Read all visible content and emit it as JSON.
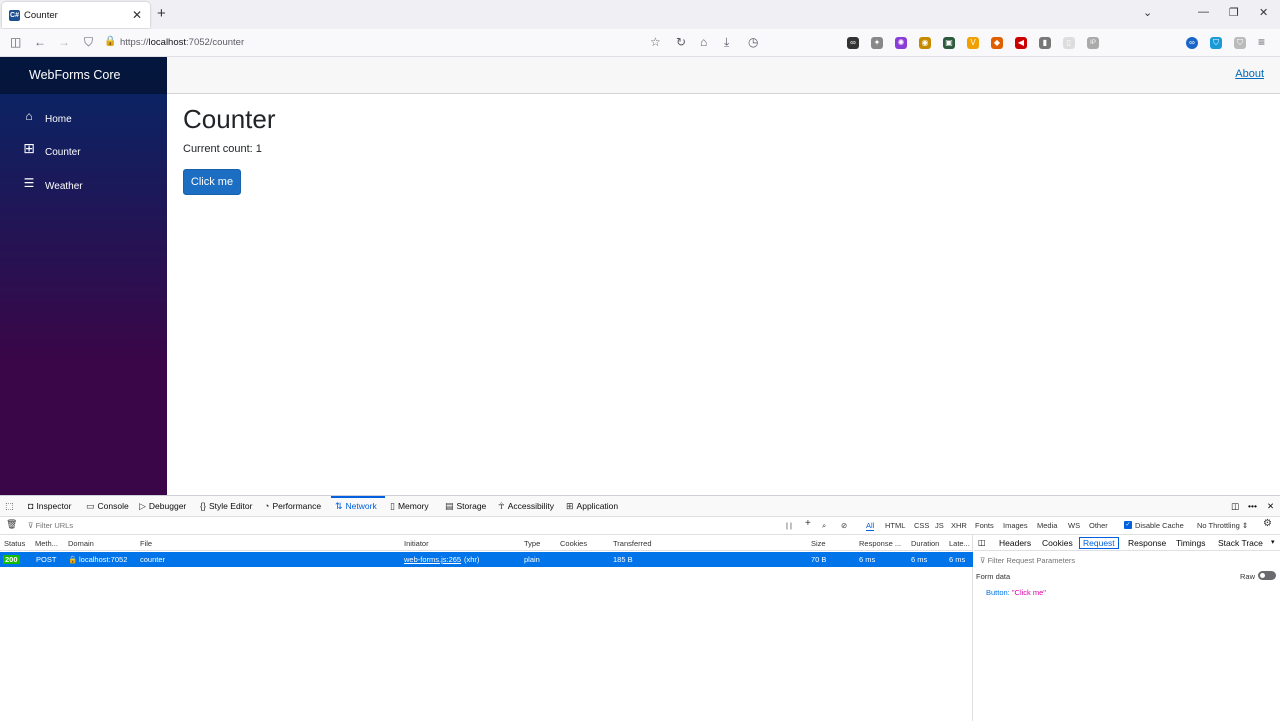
{
  "browser": {
    "tab_title": "Counter",
    "tab_close": "✕",
    "new_tab": "+",
    "url_prefix": "https://",
    "url_host": "localhost",
    "url_rest": ":7052/counter"
  },
  "app": {
    "brand": "WebForms Core",
    "about_link": "About",
    "nav": [
      {
        "label": "Home",
        "icon": "home-icon"
      },
      {
        "label": "Counter",
        "icon": "plus-icon"
      },
      {
        "label": "Weather",
        "icon": "list-icon"
      }
    ],
    "page_title": "Counter",
    "current_count": "Current count: 1",
    "button_label": "Click me"
  },
  "devtools": {
    "tabs": [
      "Inspector",
      "Console",
      "Debugger",
      "Style Editor",
      "Performance",
      "Network",
      "Memory",
      "Storage",
      "Accessibility",
      "Application"
    ],
    "active_tab": "Network",
    "filter_urls_placeholder": "Filter URLs",
    "pause": "| |",
    "type_filters": [
      "All",
      "HTML",
      "CSS",
      "JS",
      "XHR",
      "Fonts",
      "Images",
      "Media",
      "WS",
      "Other"
    ],
    "disable_cache": "Disable Cache",
    "throttling": "No Throttling ⇕",
    "columns": [
      "Status",
      "Meth...",
      "Domain",
      "File",
      "Initiator",
      "Type",
      "Cookies",
      "Transferred",
      "Size",
      "Response ...",
      "Duration",
      "Late..."
    ],
    "request": {
      "status": "200",
      "method": "POST",
      "domain": "localhost:7052",
      "file": "counter",
      "initiator_link": "web-forms.js:265",
      "initiator_type": "(xhr)",
      "type": "plain",
      "transferred": "185 B",
      "size": "70 B",
      "response": "6 ms",
      "duration": "6 ms",
      "latency": "6 ms"
    },
    "side_tabs": [
      "Headers",
      "Cookies",
      "Request",
      "Response",
      "Timings",
      "Stack Trace"
    ],
    "active_side_tab": "Request",
    "filter_params_placeholder": "Filter Request Parameters",
    "form_data_label": "Form data",
    "raw_label": "Raw",
    "form_field_key": "Button:",
    "form_field_value": "\"Click me\""
  },
  "colors": {
    "sidebar_top": "#052767",
    "sidebar_bottom": "#3a0647",
    "button": "#1b6ec2",
    "devtools_accent": "#0060df",
    "selected_row": "#0074e8",
    "status_ok": "#12bc00"
  }
}
